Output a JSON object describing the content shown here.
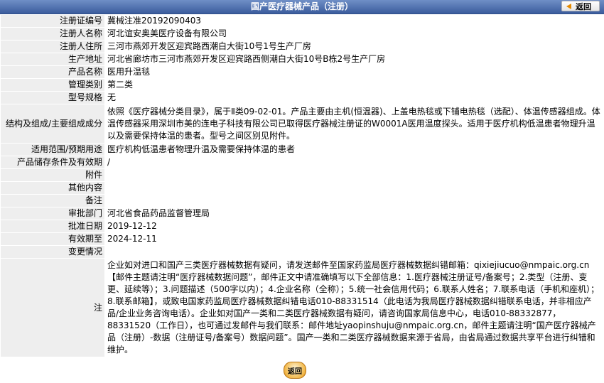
{
  "header": {
    "title": "国产医疗器械产品（注册）",
    "back_button": "返回"
  },
  "rows": {
    "reg_no": {
      "label": "注册证编号",
      "value": "冀械注准20192090403"
    },
    "registrant": {
      "label": "注册人名称",
      "value": "河北谊安奥美医疗设备有限公司"
    },
    "registrant_addr": {
      "label": "注册人住所",
      "value": "三河市燕郊开发区迎宾路西潮白大街10号1号生产厂房"
    },
    "production_addr": {
      "label": "生产地址",
      "value": "河北省廊坊市三河市燕郊开发区迎宾路西侧潮白大街10号B栋2号生产厂房"
    },
    "product_name": {
      "label": "产品名称",
      "value": "医用升温毯"
    },
    "mgmt_class": {
      "label": "管理类别",
      "value": "第二类"
    },
    "model": {
      "label": "型号规格",
      "value": "无"
    },
    "structure": {
      "label": "结构及组成/主要组成成分",
      "value": "依照《医疗器械分类目录》，属于Ⅱ类09-02-01。产品主要由主机(恒温器)、上盖电热毯或下铺电热毯（选配）、体温传感器组成。体温传感器采用深圳市美的连电子科技有限公司已取得医疗器械注册证的W0001A医用温度探头。适用于医疗机构低温患者物理升温以及需要保持体温的患者。型号之间区别见附件。"
    },
    "scope": {
      "label": "适用范围/预期用途",
      "value": "医疗机构低温患者物理升温及需要保持体温的患者"
    },
    "storage": {
      "label": "产品储存条件及有效期",
      "value": "/"
    },
    "attachment": {
      "label": "附件",
      "value": ""
    },
    "other": {
      "label": "其他内容",
      "value": ""
    },
    "remark": {
      "label": "备注",
      "value": ""
    },
    "approval_dept": {
      "label": "审批部门",
      "value": "河北省食品药品监督管理局"
    },
    "approval_date": {
      "label": "批准日期",
      "value": "2019-12-12"
    },
    "valid_until": {
      "label": "有效期至",
      "value": "2024-12-11"
    },
    "changes": {
      "label": "变更情况",
      "value": ""
    },
    "note": {
      "label": "注",
      "value": "企业如对进口和国产三类医疗器械数据有疑问，请发送邮件至国家药监局医疗器械数据纠错邮箱：qixiejiucuo@nmpaic.org.cn【邮件主题请注明“医疗器械数据问题”，邮件正文中请准确填写以下全部信息：1.医疗器械注册证号/备案号；2.类型（注册、变更、延续等）；3.问题描述（500字以内）；4.企业名称（全称）；5.统一社会信用代码；6.联系人姓名；7.联系电话（手机和座机）；8.联系邮箱】，或致电国家药监局医疗器械数据纠错电话010-88331514（此电话为我局医疗器械数据纠错联系电话，并非相应产品/企业业务咨询电话）。企业如对国产一类和二类医疗器械数据有疑问，请咨询国家局信息中心，电话010-88332877，88331520（工作日），也可通过发邮件与我们联系：邮件地址yaopinshuju@nmpaic.org.cn，邮件主题请注明“国产医疗器械产品（注册）-数据（注册证号/备案号）数据问题”。国产一类和二类医疗器械数据来源于省局，由省局通过数据共享平台进行纠错和维护。"
    }
  },
  "footer": {
    "back_button": "返回"
  }
}
